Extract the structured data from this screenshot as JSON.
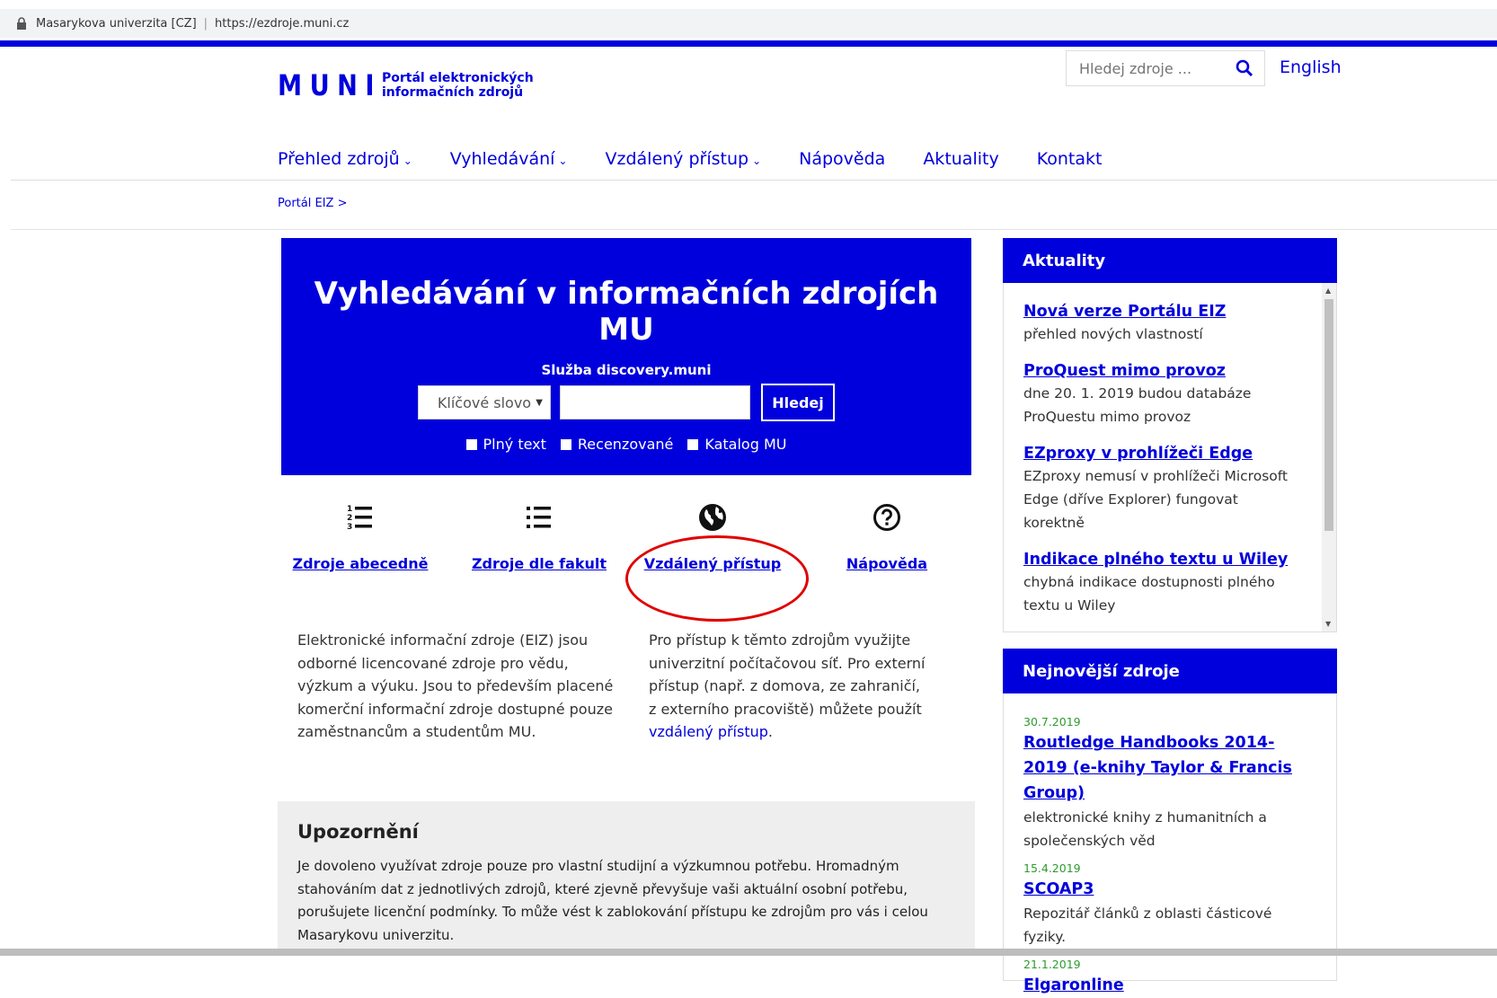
{
  "browser": {
    "site_name": "Masarykova univerzita [CZ]",
    "url": "https://ezdroje.muni.cz"
  },
  "header": {
    "logo_mark": "MUNI",
    "logo_line1": "Portál elektronických",
    "logo_line2": "informačních zdrojů",
    "search_placeholder": "Hledej zdroje ...",
    "language_link": "English"
  },
  "nav": {
    "items": [
      {
        "label": "Přehled zdrojů",
        "has_dropdown": true
      },
      {
        "label": "Vyhledávání",
        "has_dropdown": true
      },
      {
        "label": "Vzdálený přístup",
        "has_dropdown": true
      },
      {
        "label": "Nápověda",
        "has_dropdown": false
      },
      {
        "label": "Aktuality",
        "has_dropdown": false
      },
      {
        "label": "Kontakt",
        "has_dropdown": false
      }
    ],
    "chevron": "⌄"
  },
  "breadcrumb": "Portál EIZ >",
  "hero": {
    "title": "Vyhledávání v informačních zdrojích MU",
    "subtitle": "Služba discovery.muni",
    "select_value": "Klíčové slovo",
    "search_button": "Hledej",
    "checkboxes": [
      "Plný text",
      "Recenzované",
      "Katalog MU"
    ]
  },
  "quick_links": [
    {
      "label": "Zdroje abecedně",
      "icon": "numbered-list-icon"
    },
    {
      "label": "Zdroje dle fakult",
      "icon": "bullet-list-icon"
    },
    {
      "label": "Vzdálený přístup",
      "icon": "globe-icon"
    },
    {
      "label": "Nápověda",
      "icon": "help-circle-icon"
    }
  ],
  "intro_left": [
    "Elektronické informační zdroje (EIZ) jsou",
    "odborné licencované zdroje pro vědu,",
    "výzkum a výuku. Jsou to především placené",
    "komerční informační zdroje dostupné pouze",
    "zaměstnancům a studentům MU."
  ],
  "intro_right": {
    "lines": [
      "Pro přístup k těmto zdrojům využijte",
      "univerzitní počítačovou síť. Pro externí",
      "přístup (např. z domova, ze zahraničí,",
      "z externího pracoviště) můžete použít"
    ],
    "link": "vzdálený přístup",
    "after_link": "."
  },
  "warning": {
    "title": "Upozornění",
    "lines": [
      "Je dovoleno využívat zdroje pouze pro vlastní studijní a výzkumnou potřebu. Hromadným",
      "stahováním dat z jednotlivých zdrojů, které zjevně převyšuje vaši aktuální osobní potřebu,",
      "porušujete licenční podmínky. To může vést k zablokování přístupu ke zdrojům pro vás i celou",
      "Masarykovu univerzitu."
    ]
  },
  "news": {
    "title": "Aktuality",
    "items": [
      {
        "title": "Nová verze Portálu EIZ",
        "desc": [
          "přehled nových vlastností"
        ]
      },
      {
        "title": "ProQuest mimo provoz",
        "desc": [
          "dne 20. 1. 2019 budou databáze",
          "ProQuestu mimo provoz"
        ]
      },
      {
        "title": "EZproxy v prohlížeči Edge",
        "desc": [
          "EZproxy nemusí v prohlížeči Microsoft",
          "Edge (dříve Explorer) fungovat korektně"
        ]
      },
      {
        "title": "Indikace plného textu u Wiley",
        "desc": [
          "chybná indikace dostupnosti plného",
          "textu u Wiley"
        ]
      }
    ]
  },
  "new_resources": {
    "title": "Nejnovější zdroje",
    "items": [
      {
        "date": "30.7.2019",
        "title": "Routledge Handbooks 2014-2019 (e-knihy Taylor & Francis Group)",
        "desc": "elektronické knihy z humanitních a společenských věd"
      },
      {
        "date": "15.4.2019",
        "title": "SCOAP3",
        "desc": "Repozitář článků z oblasti částicové fyziky."
      },
      {
        "date": "21.1.2019",
        "title": "Elgaronline",
        "desc": ""
      }
    ]
  },
  "colors": {
    "brand": "#0000dc",
    "highlight_ring": "#e00000",
    "date_green": "#2e9b2e"
  }
}
